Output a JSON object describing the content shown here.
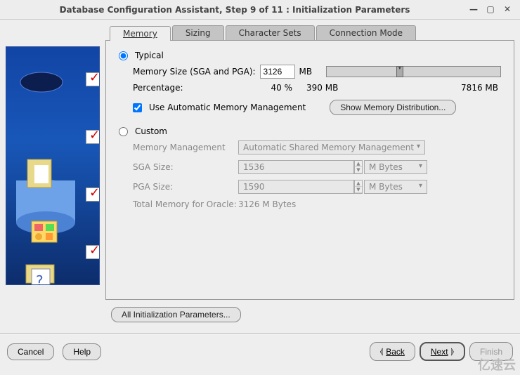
{
  "window": {
    "title": "Database Configuration Assistant, Step 9 of 11 : Initialization Parameters"
  },
  "tabs": {
    "memory": "Memory",
    "sizing": "Sizing",
    "charsets": "Character Sets",
    "connmode": "Connection Mode"
  },
  "typical": {
    "label": "Typical",
    "memsize_label": "Memory Size (SGA and PGA):",
    "memsize_value": "3126",
    "mb": "MB",
    "pct_label": "Percentage:",
    "pct_value": "40 %",
    "min_label": "390 MB",
    "max_label": "7816 MB",
    "auto_label": "Use Automatic Memory Management",
    "show_btn": "Show Memory Distribution..."
  },
  "custom": {
    "label": "Custom",
    "mgmt_label": "Memory Management",
    "mgmt_value": "Automatic Shared Memory Management",
    "sga_label": "SGA Size:",
    "sga_value": "1536",
    "pga_label": "PGA Size:",
    "pga_value": "1590",
    "unit": "M Bytes",
    "total_label": "Total Memory for Oracle:",
    "total_value": "3126 M Bytes"
  },
  "all_params_btn": "All Initialization Parameters...",
  "footer": {
    "cancel": "Cancel",
    "help": "Help",
    "back": "Back",
    "next": "Next",
    "finish": "Finish"
  },
  "watermark": "亿速云"
}
